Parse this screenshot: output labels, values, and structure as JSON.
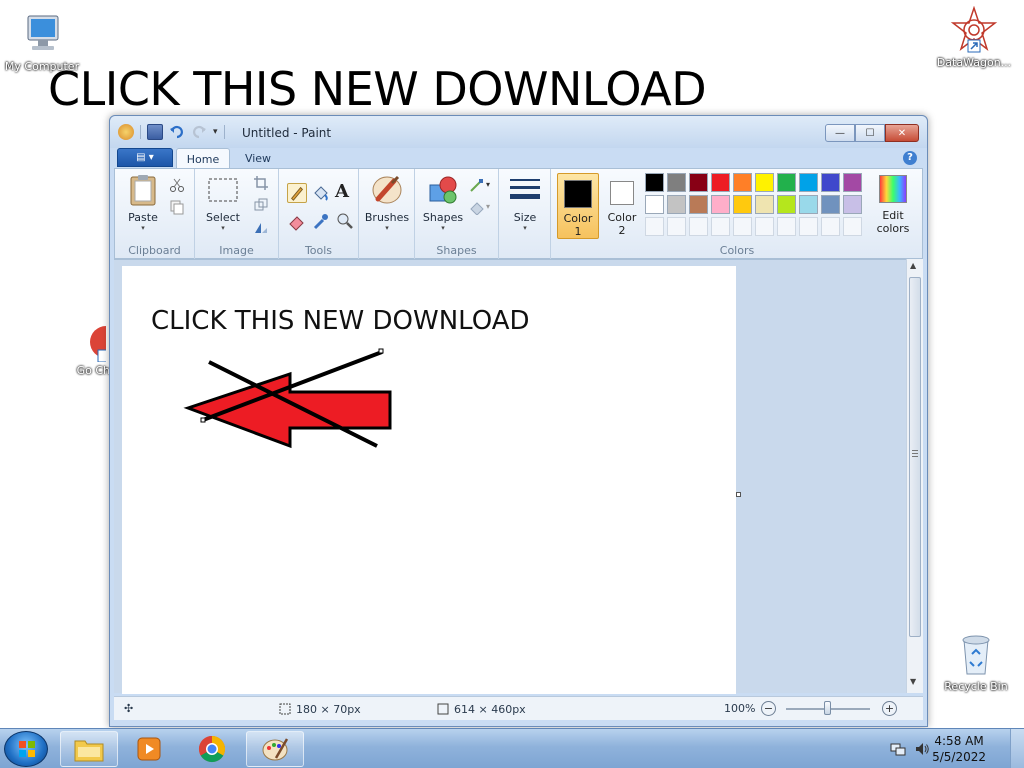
{
  "desktop": {
    "banner": "CLICK THIS NEW DOWNLOAD",
    "icons": {
      "my_computer": "My Computer",
      "datawagon": "DataWagon...",
      "chrome_partial": "Go Ch",
      "recycle_bin": "Recycle Bin"
    }
  },
  "window": {
    "title": "Untitled - Paint",
    "controls": {
      "minimize": "—",
      "maximize": "☐",
      "close": "✕"
    }
  },
  "ribbon": {
    "file_menu": "▤ ▾",
    "tabs": [
      "Home",
      "View"
    ],
    "active_tab": "Home",
    "help": "?",
    "groups": {
      "clipboard": {
        "label": "Clipboard",
        "paste": "Paste"
      },
      "image": {
        "label": "Image",
        "select": "Select"
      },
      "tools": {
        "label": "Tools"
      },
      "brushes": {
        "label": "Brushes"
      },
      "shapes": {
        "label": "Shapes",
        "shapes": "Shapes"
      },
      "size": {
        "label": "Size"
      },
      "colors": {
        "label": "Colors",
        "color1": "Color 1",
        "color2": "Color 2",
        "edit_colors": "Edit colors",
        "color1_value": "#000000",
        "color2_value": "#ffffff",
        "palette_row1": [
          "#000000",
          "#7f7f7f",
          "#880015",
          "#ed1c24",
          "#ff7f27",
          "#fff200",
          "#22b14c",
          "#00a2e8",
          "#3f48cc",
          "#a349a4"
        ],
        "palette_row2": [
          "#ffffff",
          "#c3c3c3",
          "#b97a57",
          "#ffaec9",
          "#ffc90e",
          "#efe4b0",
          "#b5e61d",
          "#99d9ea",
          "#7092be",
          "#c8bfe7"
        ]
      }
    }
  },
  "canvas": {
    "text": "CLICK THIS NEW DOWNLOAD",
    "arrow_color": "#ed1c24"
  },
  "status": {
    "selection_size": "180 × 70px",
    "canvas_size": "614 × 460px",
    "zoom": "100%",
    "zoom_minus": "−",
    "zoom_plus": "+"
  },
  "taskbar": {
    "time": "4:58 AM",
    "date": "5/5/2022"
  }
}
